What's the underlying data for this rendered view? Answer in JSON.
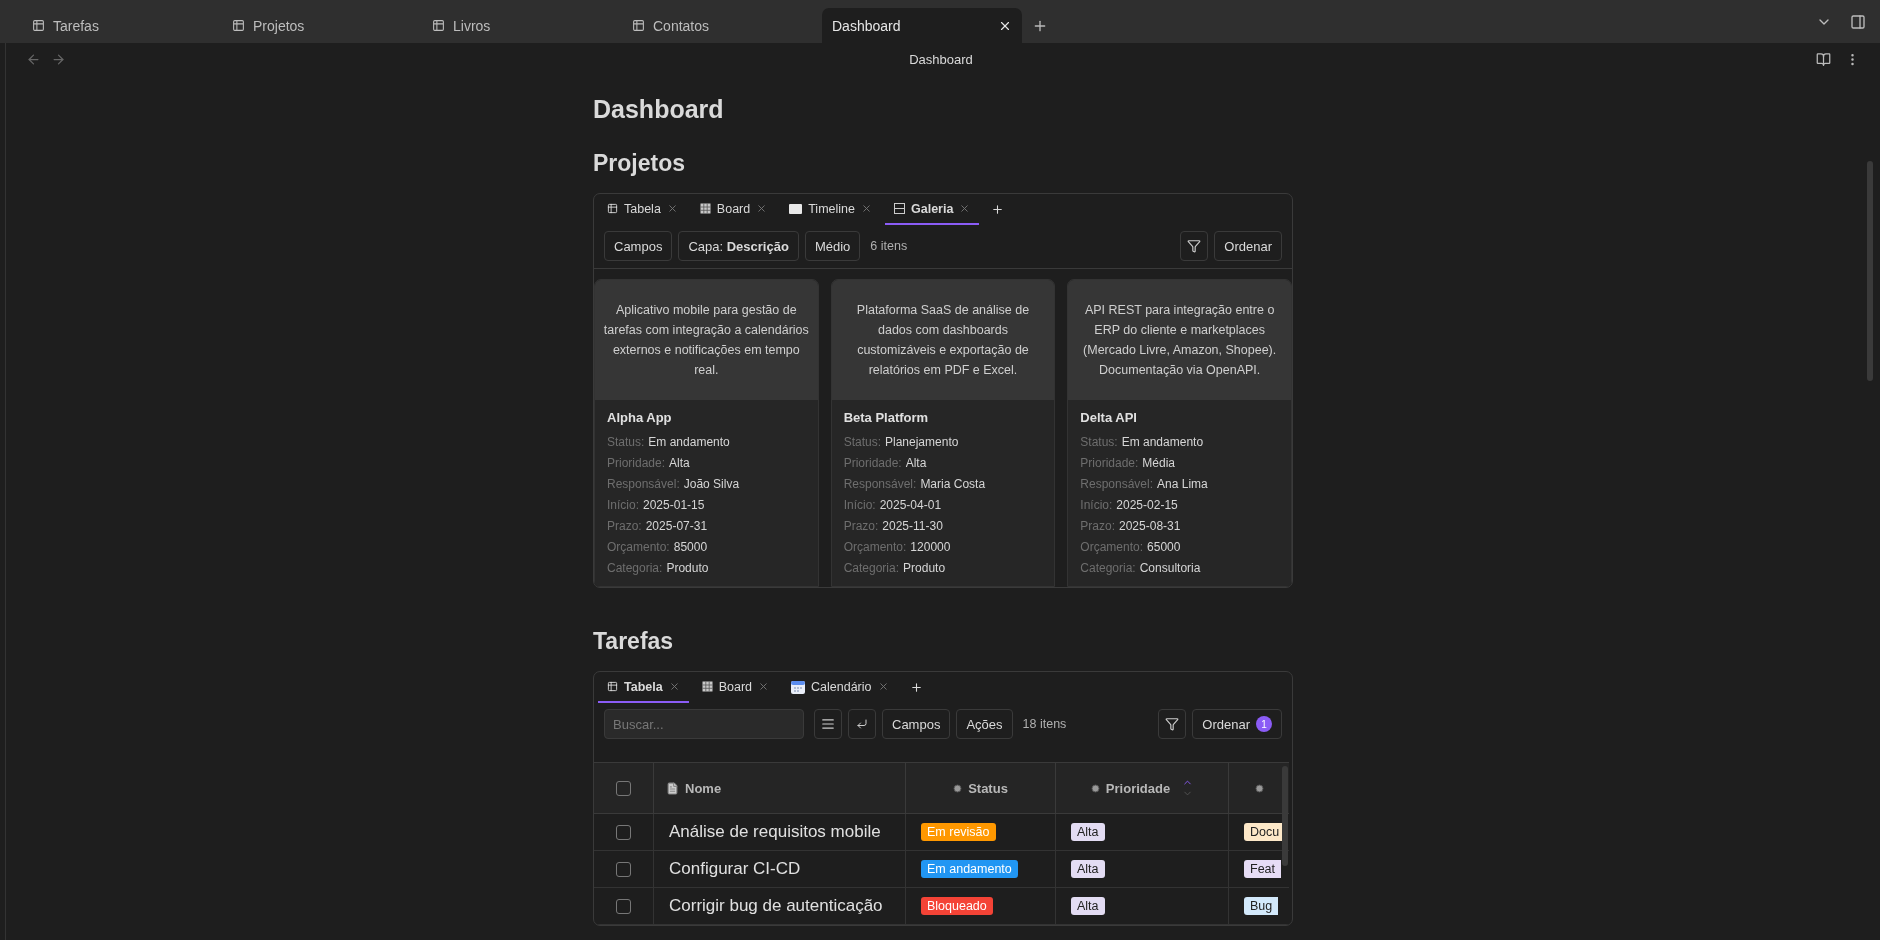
{
  "window_tabs": [
    {
      "label": "Tarefas",
      "selected": false
    },
    {
      "label": "Projetos",
      "selected": false
    },
    {
      "label": "Livros",
      "selected": false
    },
    {
      "label": "Contatos",
      "selected": false
    },
    {
      "label": "Dashboard",
      "selected": true
    }
  ],
  "nav": {
    "title": "Dashboard"
  },
  "page": {
    "title": "Dashboard"
  },
  "projetos": {
    "heading": "Projetos",
    "views": [
      {
        "kind": "table",
        "label": "Tabela",
        "selected": false
      },
      {
        "kind": "board",
        "label": "Board",
        "selected": false
      },
      {
        "kind": "timeline",
        "label": "Timeline",
        "selected": false
      },
      {
        "kind": "gallery",
        "label": "Galeria",
        "selected": true
      }
    ],
    "buttons": [
      "Campos",
      "Capa: **Descrição**",
      "Médio"
    ],
    "count": "6 itens",
    "sort_button": "Ordenar",
    "cards": [
      {
        "cover": "Aplicativo mobile para gestão de tarefas com integração a calendários externos e notificações em tempo real.",
        "title": "Alpha App",
        "fields": [
          {
            "label": "Status:",
            "value": "Em andamento"
          },
          {
            "label": "Prioridade:",
            "value": "Alta"
          },
          {
            "label": "Responsável:",
            "value": "João Silva"
          },
          {
            "label": "Início:",
            "value": "2025-01-15"
          },
          {
            "label": "Prazo:",
            "value": "2025-07-31"
          },
          {
            "label": "Orçamento:",
            "value": "85000"
          },
          {
            "label": "Categoria:",
            "value": "Produto"
          }
        ]
      },
      {
        "cover": "Plataforma SaaS de análise de dados com dashboards customizáveis e exportação de relatórios em PDF e Excel.",
        "title": "Beta Platform",
        "fields": [
          {
            "label": "Status:",
            "value": "Planejamento"
          },
          {
            "label": "Prioridade:",
            "value": "Alta"
          },
          {
            "label": "Responsável:",
            "value": "Maria Costa"
          },
          {
            "label": "Início:",
            "value": "2025-04-01"
          },
          {
            "label": "Prazo:",
            "value": "2025-11-30"
          },
          {
            "label": "Orçamento:",
            "value": "120000"
          },
          {
            "label": "Categoria:",
            "value": "Produto"
          }
        ]
      },
      {
        "cover": "API REST para integração entre o ERP do cliente e marketplaces (Mercado Livre, Amazon, Shopee). Documentação via OpenAPI.",
        "title": "Delta API",
        "fields": [
          {
            "label": "Status:",
            "value": "Em andamento"
          },
          {
            "label": "Prioridade:",
            "value": "Média"
          },
          {
            "label": "Responsável:",
            "value": "Ana Lima"
          },
          {
            "label": "Início:",
            "value": "2025-02-15"
          },
          {
            "label": "Prazo:",
            "value": "2025-08-31"
          },
          {
            "label": "Orçamento:",
            "value": "65000"
          },
          {
            "label": "Categoria:",
            "value": "Consultoria"
          }
        ]
      }
    ]
  },
  "tarefas": {
    "heading": "Tarefas",
    "views": [
      {
        "kind": "table",
        "label": "Tabela",
        "selected": true
      },
      {
        "kind": "board",
        "label": "Board",
        "selected": false
      },
      {
        "kind": "calendar",
        "label": "Calendário",
        "selected": false
      }
    ],
    "search": {
      "placeholder": "Buscar..."
    },
    "buttons": [
      "Campos",
      "Ações"
    ],
    "count": "18 itens",
    "sort_button": "Ordenar",
    "sort_badge": "1",
    "header_checked": false,
    "columns": [
      {
        "kind": "file",
        "label": "Nome",
        "sorted": false
      },
      {
        "kind": "dot",
        "label": "Status",
        "sorted": false
      },
      {
        "kind": "dot",
        "label": "Prioridade",
        "sorted": true
      },
      {
        "kind": "dot",
        "sorted": false
      }
    ],
    "rows": [
      {
        "checked": false,
        "name": "Análise de requisitos mobile",
        "status": {
          "label": "Em revisão",
          "color": "#ff9800"
        },
        "priority": {
          "label": "Alta",
          "color": "#e3dcf3"
        },
        "column_4": {
          "label": "Docu",
          "color": "#fde8c8"
        }
      },
      {
        "checked": false,
        "name": "Configurar CI-CD",
        "status": {
          "label": "Em andamento",
          "color": "#2196f3"
        },
        "priority": {
          "label": "Alta",
          "color": "#e3dcf3"
        },
        "column_4": {
          "label": "Feat",
          "color": "#e6dcf5"
        }
      },
      {
        "checked": false,
        "name": "Corrigir bug de autenticação",
        "status": {
          "label": "Bloqueado",
          "color": "#f44336"
        },
        "priority": {
          "label": "Alta",
          "color": "#e3dcf3"
        },
        "column_4": {
          "label": "Bug",
          "color": "#d3e9fb"
        }
      }
    ]
  }
}
